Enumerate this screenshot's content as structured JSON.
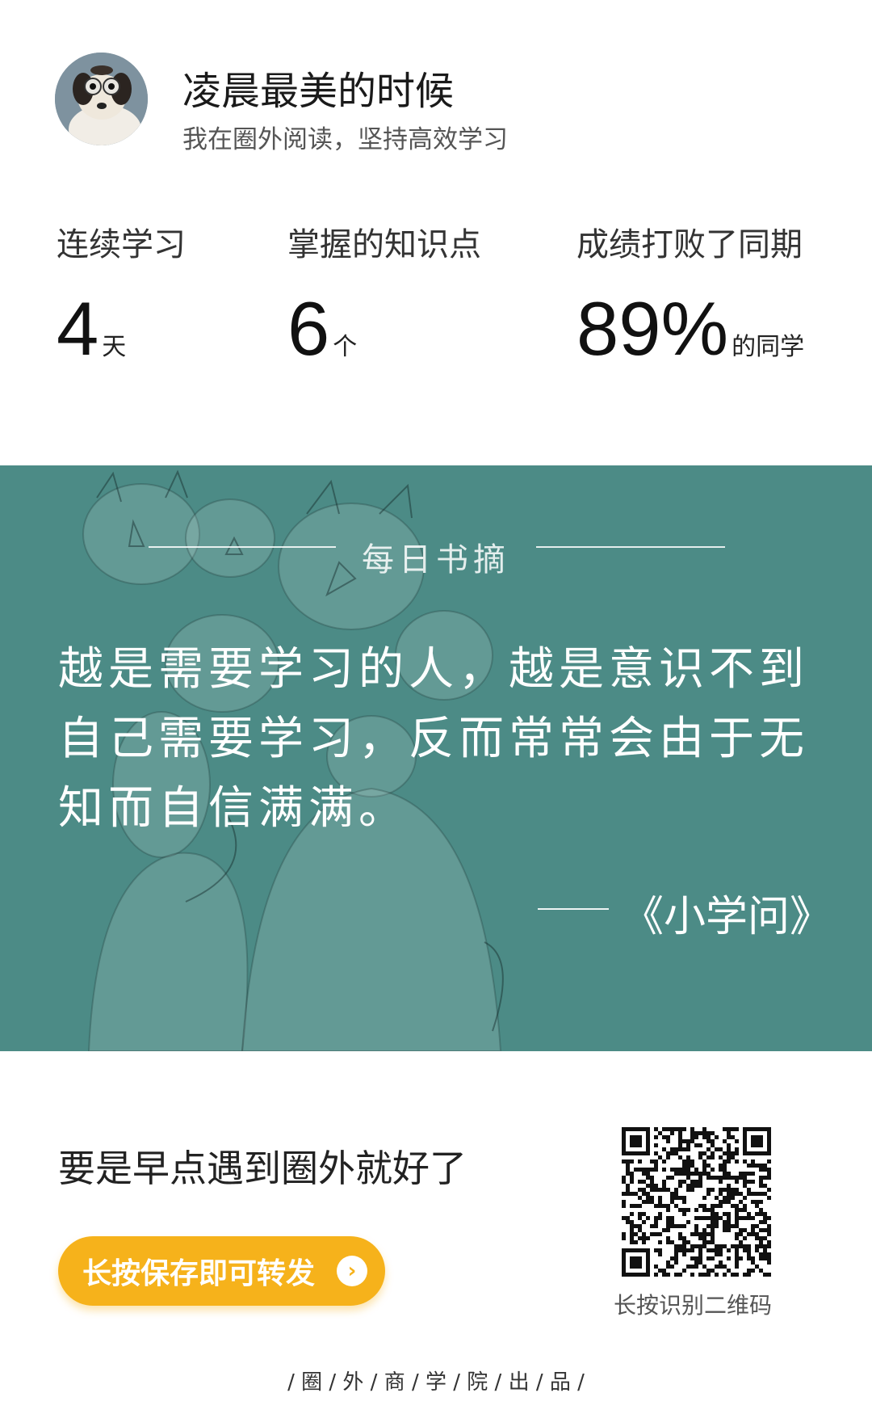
{
  "profile": {
    "username": "凌晨最美的时候",
    "tagline": "我在圈外阅读，坚持高效学习"
  },
  "stats": [
    {
      "label": "连续学习",
      "value": "4",
      "unit": "天"
    },
    {
      "label": "掌握的知识点",
      "value": "6",
      "unit": "个"
    },
    {
      "label": "成绩打败了同期",
      "value": "89%",
      "unit": "的同学"
    }
  ],
  "quote": {
    "section_title": "每日书摘",
    "text": "越是需要学习的人，越是意识不到自己需要学习，反而常常会由于无知而自信满满。",
    "source": "《小学问》"
  },
  "cta": {
    "text": "要是早点遇到圈外就好了",
    "button_label": "长按保存即可转发"
  },
  "qr": {
    "caption": "长按识别二维码"
  },
  "footer": {
    "text": "/ 圈 / 外 / 商 / 学 / 院 / 出 / 品 /"
  },
  "colors": {
    "panel": "#4c8b86",
    "button": "#f6b21b"
  },
  "icons": [
    "avatar-photo",
    "arrow-right-circle-icon",
    "qr-code"
  ]
}
